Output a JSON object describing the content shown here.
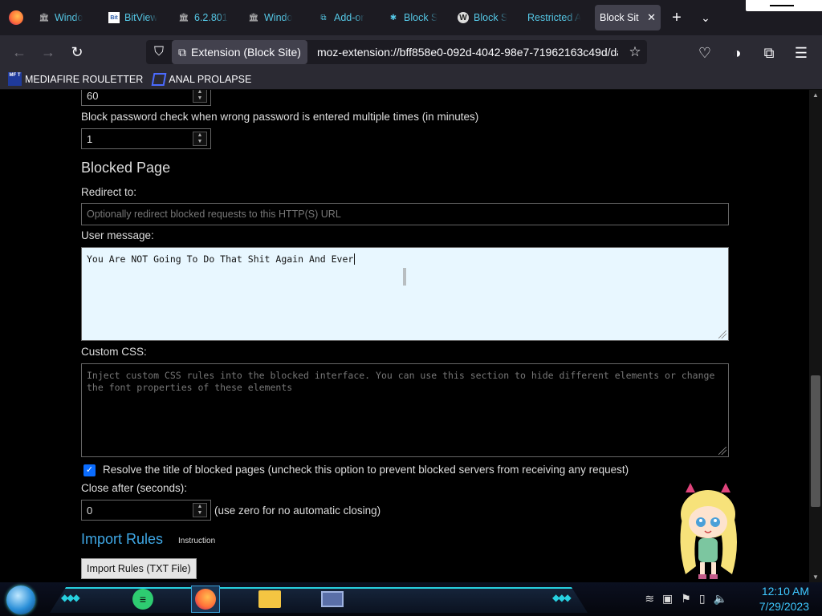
{
  "browser": {
    "tabs": [
      {
        "label": "Windo",
        "icon": "museum-icon"
      },
      {
        "label": "BitView",
        "icon": "bitview-icon"
      },
      {
        "label": "6.2.801",
        "icon": "museum-icon"
      },
      {
        "label": "Windo",
        "icon": "museum-icon"
      },
      {
        "label": "Add-or",
        "icon": "puzzle-icon"
      },
      {
        "label": "Block S",
        "icon": "blocksite-icon"
      },
      {
        "label": "Block S",
        "icon": "w-icon"
      },
      {
        "label": "Restricted A",
        "icon": ""
      },
      {
        "label": "Block Sit",
        "icon": "",
        "active": true
      }
    ],
    "identity_chip": "Extension (Block Site)",
    "url": "moz-extension://bff858e0-092d-4042-98e7-71962163c49d/da",
    "bookmarks": [
      {
        "label": "MEDIAFIRE ROULETTER",
        "icon_text": "MF T"
      },
      {
        "label": "ANAL PROLAPSE",
        "icon_text": ""
      }
    ]
  },
  "settings": {
    "top_number_value": "60",
    "block_password_label": "Block password check when wrong password is entered multiple times (in minutes)",
    "block_password_value": "1",
    "blocked_page_heading": "Blocked Page",
    "redirect_label": "Redirect to:",
    "redirect_placeholder": "Optionally redirect blocked requests to this HTTP(S) URL",
    "user_message_label": "User message:",
    "user_message_value": "You Are NOT Going To Do That Shit Again And Ever",
    "custom_css_label": "Custom CSS:",
    "custom_css_placeholder": "Inject custom CSS rules into the blocked interface. You can use this section to hide different elements or change the font properties of these elements",
    "resolve_title_label": "Resolve the title of blocked pages (uncheck this option to prevent blocked servers from receiving any request)",
    "resolve_title_checked": true,
    "close_after_label": "Close after (seconds):",
    "close_after_value": "0",
    "close_after_hint": "(use zero for no automatic closing)",
    "import_heading": "Import Rules",
    "instruction_link": "Instruction",
    "import_button": "Import Rules (TXT File)"
  },
  "taskbar": {
    "time": "12:10 AM",
    "date": "7/29/2023"
  },
  "colors": {
    "accent": "#3fa8e6",
    "tab_text": "#55c8e6",
    "clock": "#3ec8ff",
    "checkbox": "#0a6cff"
  }
}
